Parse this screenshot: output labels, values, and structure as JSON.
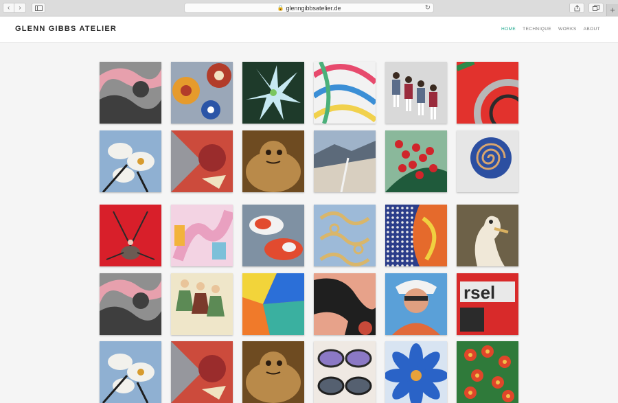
{
  "browser": {
    "url": "glenngibbsatelier.de",
    "back_glyph": "‹",
    "forward_glyph": "›",
    "reload_glyph": "↻",
    "new_tab_glyph": "+"
  },
  "site": {
    "title": "GLENN GIBBS ATELIER",
    "nav": [
      "HOME",
      "TECHNIQUE",
      "WORKS",
      "ABOUT"
    ],
    "active_nav": "HOME",
    "accent_color": "#1fa88e"
  },
  "gallery": {
    "tiles": [
      {
        "name": "pink-grey-abstract-artwork",
        "icon": "abstract",
        "colors": [
          "#8f8f8f",
          "#e7a0ad",
          "#3e3e3e"
        ]
      },
      {
        "name": "gears-artwork",
        "icon": "gears",
        "colors": [
          "#e69b2c",
          "#b23c2a",
          "#2b55a7"
        ]
      },
      {
        "name": "lily-flower-artwork",
        "icon": "flower",
        "colors": [
          "#c7e9f2",
          "#1e3a2a",
          "#7ac65e"
        ]
      },
      {
        "name": "colorful-lines-artwork",
        "icon": "lines",
        "colors": [
          "#e74a6d",
          "#3b8fd6",
          "#f1d14c"
        ]
      },
      {
        "name": "crowd-people-artwork",
        "icon": "people",
        "colors": [
          "#d9d9d9",
          "#9a2b3c",
          "#5b6d8a"
        ]
      },
      {
        "name": "red-circles-artwork",
        "icon": "circles",
        "colors": [
          "#e2322d",
          "#b7b7b7",
          "#2b2b2b"
        ]
      },
      {
        "name": "orchid-artwork",
        "icon": "orchid",
        "colors": [
          "#f2f1ec",
          "#8fb0d2",
          "#d79b2e"
        ]
      },
      {
        "name": "red-pattern-artwork",
        "icon": "pattern",
        "colors": [
          "#cc4b3c",
          "#7fb8c6",
          "#9a2c2c"
        ]
      },
      {
        "name": "turtle-artwork",
        "icon": "turtle",
        "colors": [
          "#6e4b21",
          "#b98a4a",
          "#2a1c10"
        ]
      },
      {
        "name": "rooftops-landscape-artwork",
        "icon": "landscape",
        "colors": [
          "#d8cfc0",
          "#9fb3c9",
          "#5c6a7a"
        ]
      },
      {
        "name": "red-berries-artwork",
        "icon": "berries",
        "colors": [
          "#d0252b",
          "#1f5a3b",
          "#8ab89b"
        ]
      },
      {
        "name": "blue-spiral-artwork",
        "icon": "spiral",
        "colors": [
          "#2c4fa1",
          "#d8a56e",
          "#e6e6e6"
        ]
      },
      {
        "name": "insect-on-red-artwork",
        "icon": "insect",
        "colors": [
          "#d81f2a",
          "#6b5b53",
          "#f0c6b8"
        ]
      },
      {
        "name": "figure-abstract-artwork",
        "icon": "figure",
        "colors": [
          "#f3d3e3",
          "#f2b33c",
          "#7cc0d9"
        ]
      },
      {
        "name": "koi-fish-artwork",
        "icon": "fish",
        "colors": [
          "#e24b2f",
          "#f2f2f2",
          "#7f91a3"
        ]
      },
      {
        "name": "gold-swirls-artwork",
        "icon": "swirls",
        "colors": [
          "#9dbad8",
          "#d9b66a",
          "#e6e6e6"
        ]
      },
      {
        "name": "dots-orange-artwork",
        "icon": "dots",
        "colors": [
          "#e56a2c",
          "#2b3d8a",
          "#e9e9e9"
        ]
      },
      {
        "name": "goose-artwork",
        "icon": "goose",
        "colors": [
          "#f0e8d8",
          "#6d6148",
          "#b1a58b"
        ]
      },
      {
        "name": "pink-grey-abstract-artwork-2",
        "icon": "abstract",
        "colors": [
          "#8f8f8f",
          "#e7a0ad",
          "#3e3e3e"
        ]
      },
      {
        "name": "dancers-artwork",
        "icon": "dancers",
        "colors": [
          "#efe6c9",
          "#7a3a2b",
          "#5c8a55"
        ]
      },
      {
        "name": "color-patches-artwork",
        "icon": "patches",
        "colors": [
          "#e23a8a",
          "#f2d43a",
          "#2b6fd8"
        ]
      },
      {
        "name": "bodies-artwork",
        "icon": "bodies",
        "colors": [
          "#e7a28a",
          "#1f1f1f",
          "#c84a3a"
        ]
      },
      {
        "name": "woman-sunglasses-artwork",
        "icon": "woman",
        "colors": [
          "#5aa0d8",
          "#e16a3a",
          "#f2f2f2"
        ]
      },
      {
        "name": "sign-letters-artwork",
        "icon": "sign",
        "colors": [
          "#d82a2a",
          "#2b2b2b",
          "#e9e9e9"
        ]
      },
      {
        "name": "orchid-artwork-2",
        "icon": "orchid",
        "colors": [
          "#f2f1ec",
          "#8fb0d2",
          "#d79b2e"
        ]
      },
      {
        "name": "red-pattern-artwork-2",
        "icon": "pattern",
        "colors": [
          "#cc4b3c",
          "#7fb8c6",
          "#9a2c2c"
        ]
      },
      {
        "name": "turtle-artwork-2",
        "icon": "turtle",
        "colors": [
          "#6e4b21",
          "#b98a4a",
          "#2a1c10"
        ]
      },
      {
        "name": "sunglasses-artwork",
        "icon": "sunglasses",
        "colors": [
          "#efe9e3",
          "#8b79c5",
          "#1f1f1f"
        ]
      },
      {
        "name": "blue-flower-artwork",
        "icon": "blueflower",
        "colors": [
          "#2a63c7",
          "#f2f2f2",
          "#e8a23a"
        ]
      },
      {
        "name": "red-flowers-artwork",
        "icon": "redflowers",
        "colors": [
          "#e0462a",
          "#2f7a3a",
          "#f1c04a"
        ]
      }
    ]
  }
}
